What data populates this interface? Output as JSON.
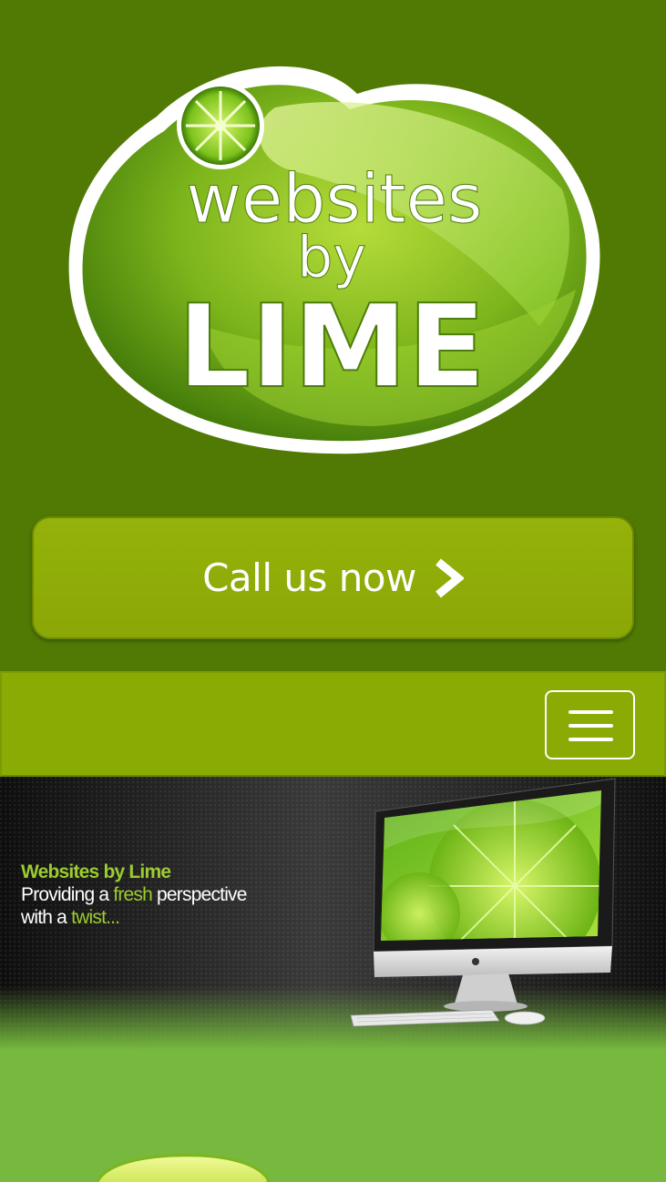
{
  "logo": {
    "line1": "websites",
    "line2": "by",
    "line3": "LIME"
  },
  "call_button": {
    "label": "Call us now",
    "icon": "chevron-right-icon"
  },
  "navbar": {
    "toggle_icon": "hamburger-menu-icon"
  },
  "hero": {
    "title": "Websites by Lime",
    "line2_prefix": "Providing a",
    "line2_highlight": "fresh",
    "line2_suffix": "perspective",
    "line3_prefix": "with a",
    "line3_highlight": "twist..."
  },
  "colors": {
    "page_background": "#507a04",
    "button_green": "#8fad08",
    "navbar_green": "#8aab04",
    "lower_green": "#76b93e",
    "highlight_green": "#9ccc2e"
  }
}
